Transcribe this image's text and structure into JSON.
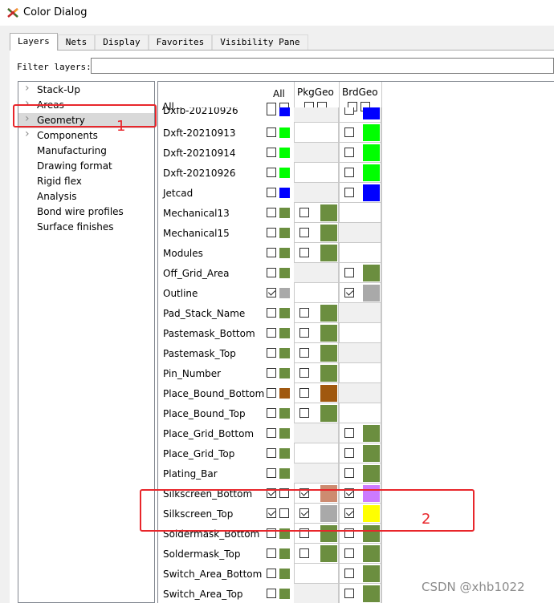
{
  "window": {
    "title": "Color Dialog",
    "icon": "color-dialog-app-icon"
  },
  "tabs": [
    {
      "label": "Layers",
      "active": true
    },
    {
      "label": "Nets",
      "active": false
    },
    {
      "label": "Display",
      "active": false
    },
    {
      "label": "Favorites",
      "active": false
    },
    {
      "label": "Visibility Pane",
      "active": false
    }
  ],
  "filter": {
    "label": "Filter layers:",
    "value": ""
  },
  "tree": [
    {
      "label": "Stack-Up",
      "expandable": true,
      "selected": false
    },
    {
      "label": "Areas",
      "expandable": true,
      "selected": false
    },
    {
      "label": "Geometry",
      "expandable": true,
      "selected": true
    },
    {
      "label": "Components",
      "expandable": true,
      "selected": false
    },
    {
      "label": "Manufacturing",
      "expandable": false,
      "selected": false
    },
    {
      "label": "Drawing format",
      "expandable": false,
      "selected": false
    },
    {
      "label": "Rigid flex",
      "expandable": false,
      "selected": false
    },
    {
      "label": "Analysis",
      "expandable": false,
      "selected": false
    },
    {
      "label": "Bond wire profiles",
      "expandable": false,
      "selected": false
    },
    {
      "label": "Surface finishes",
      "expandable": false,
      "selected": false
    }
  ],
  "grid": {
    "headers": {
      "all_top": "All",
      "all_left": "All",
      "pkg": "PkgGeo",
      "brd": "BrdGeo"
    },
    "partial_row": {
      "name": "Dxfb-20210926"
    },
    "rows": [
      {
        "name": "Dxft-20210913",
        "all_checked": false,
        "all_color": "#00ff00",
        "pkg": null,
        "brd": {
          "checked": false,
          "color": "#00ff00"
        }
      },
      {
        "name": "Dxft-20210914",
        "all_checked": false,
        "all_color": "#00ff00",
        "pkg": null,
        "brd": {
          "checked": false,
          "color": "#00ff00"
        }
      },
      {
        "name": "Dxft-20210926",
        "all_checked": false,
        "all_color": "#00ff00",
        "pkg": null,
        "brd": {
          "checked": false,
          "color": "#00ff00"
        }
      },
      {
        "name": "Jetcad",
        "all_checked": false,
        "all_color": "#0000ff",
        "pkg": null,
        "brd": {
          "checked": false,
          "color": "#0000ff"
        }
      },
      {
        "name": "Mechanical13",
        "all_checked": false,
        "all_color": "#6b8e3f",
        "pkg": {
          "checked": false,
          "color": "#6b8e3f"
        },
        "brd": null
      },
      {
        "name": "Mechanical15",
        "all_checked": false,
        "all_color": "#6b8e3f",
        "pkg": {
          "checked": false,
          "color": "#6b8e3f"
        },
        "brd": null
      },
      {
        "name": "Modules",
        "all_checked": false,
        "all_color": "#6b8e3f",
        "pkg": {
          "checked": false,
          "color": "#6b8e3f"
        },
        "brd": null
      },
      {
        "name": "Off_Grid_Area",
        "all_checked": false,
        "all_color": "#6b8e3f",
        "pkg": null,
        "brd": {
          "checked": false,
          "color": "#6b8e3f"
        }
      },
      {
        "name": "Outline",
        "all_checked": true,
        "all_color": "#a9a9a9",
        "pkg": null,
        "brd": {
          "checked": true,
          "color": "#a9a9a9"
        }
      },
      {
        "name": "Pad_Stack_Name",
        "all_checked": false,
        "all_color": "#6b8e3f",
        "pkg": {
          "checked": false,
          "color": "#6b8e3f"
        },
        "brd": null
      },
      {
        "name": "Pastemask_Bottom",
        "all_checked": false,
        "all_color": "#6b8e3f",
        "pkg": {
          "checked": false,
          "color": "#6b8e3f"
        },
        "brd": null
      },
      {
        "name": "Pastemask_Top",
        "all_checked": false,
        "all_color": "#6b8e3f",
        "pkg": {
          "checked": false,
          "color": "#6b8e3f"
        },
        "brd": null
      },
      {
        "name": "Pin_Number",
        "all_checked": false,
        "all_color": "#6b8e3f",
        "pkg": {
          "checked": false,
          "color": "#6b8e3f"
        },
        "brd": null
      },
      {
        "name": "Place_Bound_Bottom",
        "all_checked": false,
        "all_color": "#a0580f",
        "pkg": {
          "checked": false,
          "color": "#a0580f"
        },
        "brd": null
      },
      {
        "name": "Place_Bound_Top",
        "all_checked": false,
        "all_color": "#6b8e3f",
        "pkg": {
          "checked": false,
          "color": "#6b8e3f"
        },
        "brd": null
      },
      {
        "name": "Place_Grid_Bottom",
        "all_checked": false,
        "all_color": "#6b8e3f",
        "pkg": null,
        "brd": {
          "checked": false,
          "color": "#6b8e3f"
        }
      },
      {
        "name": "Place_Grid_Top",
        "all_checked": false,
        "all_color": "#6b8e3f",
        "pkg": null,
        "brd": {
          "checked": false,
          "color": "#6b8e3f"
        }
      },
      {
        "name": "Plating_Bar",
        "all_checked": false,
        "all_color": "#6b8e3f",
        "pkg": null,
        "brd": {
          "checked": false,
          "color": "#6b8e3f"
        }
      },
      {
        "name": "Silkscreen_Bottom",
        "all_checked": true,
        "all_color": null,
        "pkg": {
          "checked": true,
          "color": "#cd8b70"
        },
        "brd": {
          "checked": true,
          "color": "#cc7aff"
        }
      },
      {
        "name": "Silkscreen_Top",
        "all_checked": true,
        "all_color": null,
        "pkg": {
          "checked": true,
          "color": "#a9a9a9"
        },
        "brd": {
          "checked": true,
          "color": "#ffff00"
        }
      },
      {
        "name": "Soldermask_Bottom",
        "all_checked": false,
        "all_color": "#6b8e3f",
        "pkg": {
          "checked": false,
          "color": "#6b8e3f"
        },
        "brd": {
          "checked": false,
          "color": "#6b8e3f"
        }
      },
      {
        "name": "Soldermask_Top",
        "all_checked": false,
        "all_color": "#6b8e3f",
        "pkg": {
          "checked": false,
          "color": "#6b8e3f"
        },
        "brd": {
          "checked": false,
          "color": "#6b8e3f"
        }
      },
      {
        "name": "Switch_Area_Bottom",
        "all_checked": false,
        "all_color": "#6b8e3f",
        "pkg": null,
        "brd": {
          "checked": false,
          "color": "#6b8e3f"
        }
      },
      {
        "name": "Switch_Area_Top",
        "all_checked": false,
        "all_color": "#6b8e3f",
        "pkg": null,
        "brd": {
          "checked": false,
          "color": "#6b8e3f"
        }
      }
    ]
  },
  "annotations": {
    "label_1": "1",
    "label_2": "2",
    "color": "#e8262b"
  },
  "watermark": "CSDN @xhb1022"
}
